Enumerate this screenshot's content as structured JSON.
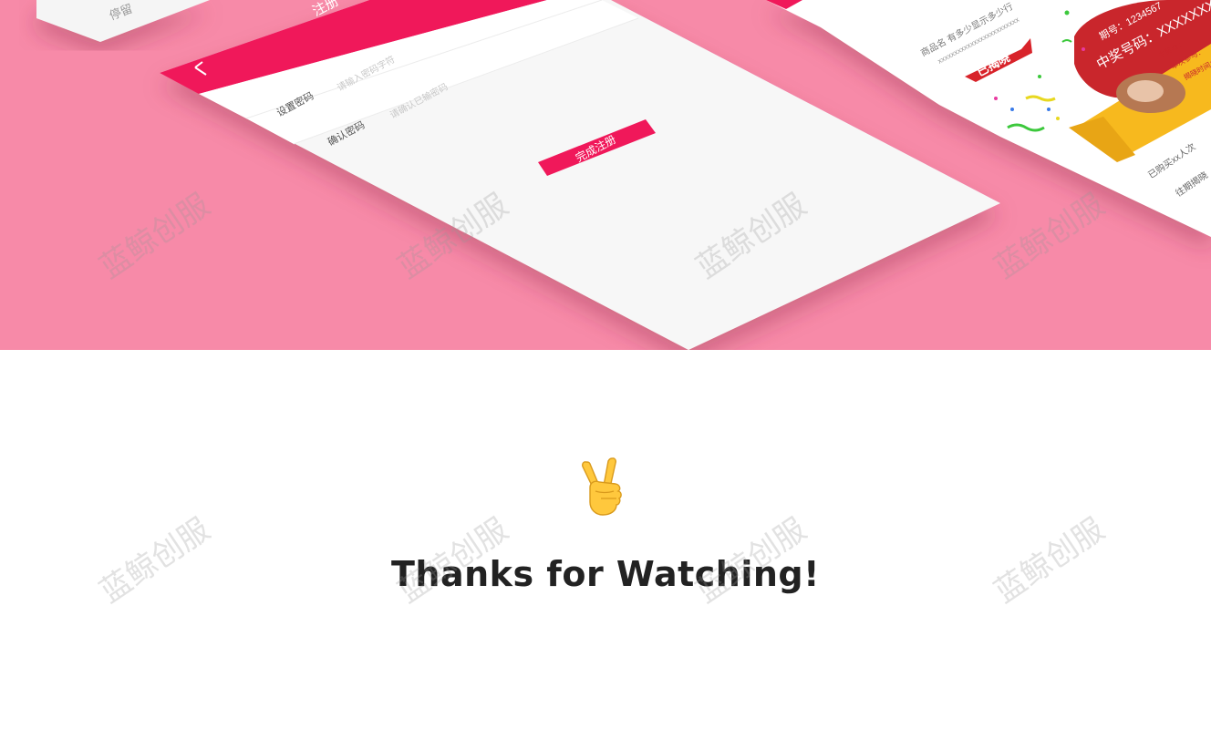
{
  "hero": {
    "left_card": {
      "label": "停留"
    },
    "register_screen": {
      "title": "注册",
      "back_icon": "chevron-left-icon",
      "fields": [
        {
          "label": "设置密码",
          "placeholder": "请输入密码字符"
        },
        {
          "label": "确认密码",
          "placeholder": "请确认已输密码"
        }
      ],
      "submit_label": "完成注册"
    },
    "right_screen": {
      "product_line": "商品名 有多少显示多少行",
      "code_line": "xxxxxxxxxxxxxxxxxxxxxxxxx",
      "status_tag": "已揭晓",
      "ribbon_period": "期号：1234567",
      "ribbon_number": "中奖号码：XXXXXXXX",
      "winner_lines": [
        "中奖者：",
        "本次参与：",
        "揭晓时间："
      ],
      "bought_line": "已购买xx人次",
      "history_line": "往期揭晓"
    },
    "colors": {
      "background": "#f78aa8",
      "accent": "#f0185a",
      "panel": "#f7f7f7"
    }
  },
  "closing": {
    "emoji": "peace-hand-icon",
    "message": "Thanks for Watching!"
  },
  "watermark": {
    "text": "蓝鲸创服"
  }
}
